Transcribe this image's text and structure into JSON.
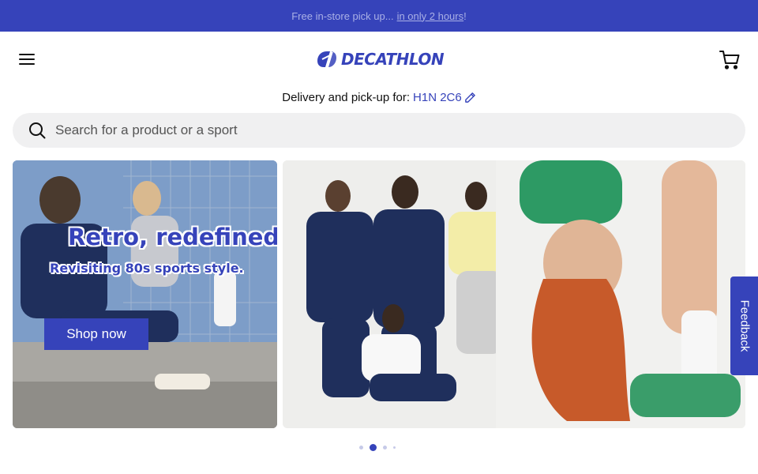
{
  "promo": {
    "text": "Free in-store pick up...",
    "link": "in only 2 hours",
    "suffix": "!"
  },
  "header": {
    "logo_text": "DECATHLON",
    "menu_icon": "hamburger-menu-icon",
    "cart_icon": "cart-icon"
  },
  "delivery": {
    "label": "Delivery and pick-up for:",
    "postal_code": "H1N 2C6",
    "edit_icon": "pencil-icon"
  },
  "search": {
    "placeholder": "Search for a product or a sport",
    "icon": "search-icon"
  },
  "hero": {
    "title": "Retro, redefined",
    "subtitle": "Revisiting 80s sports style.",
    "cta_label": "Shop now"
  },
  "carousel": {
    "active_index": 1,
    "count": 4
  },
  "feedback": {
    "label": "Feedback"
  },
  "colors": {
    "brand": "#3643ba",
    "search_bg": "#f0f0f1"
  }
}
